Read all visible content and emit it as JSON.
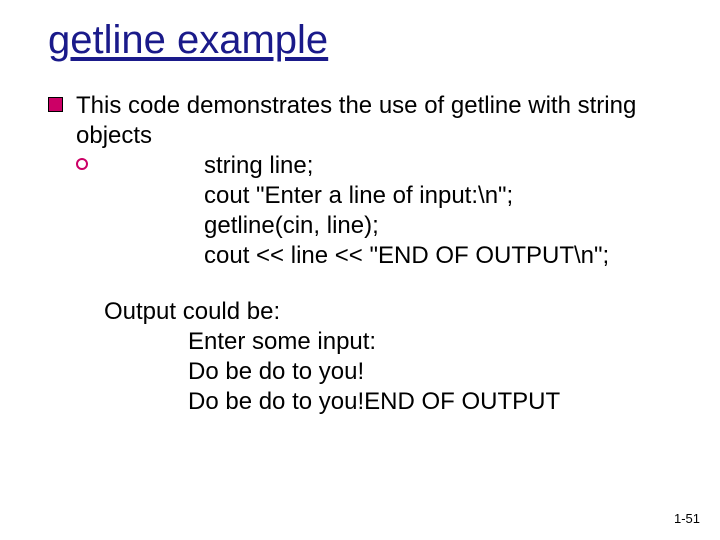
{
  "title": "getline example",
  "bullet_text": "This code demonstrates the use of getline with string objects",
  "code": {
    "l1": "string line;",
    "l2": "cout \"Enter a line of input:\\n\";",
    "l3": "getline(cin, line);",
    "l4": "cout << line << \"END OF OUTPUT\\n\";"
  },
  "output_heading": "Output could be:",
  "output": {
    "l1": "Enter some input:",
    "l2": "Do be do to you!",
    "l3": "Do be do to you!END OF OUTPUT"
  },
  "page_number": "1-51"
}
